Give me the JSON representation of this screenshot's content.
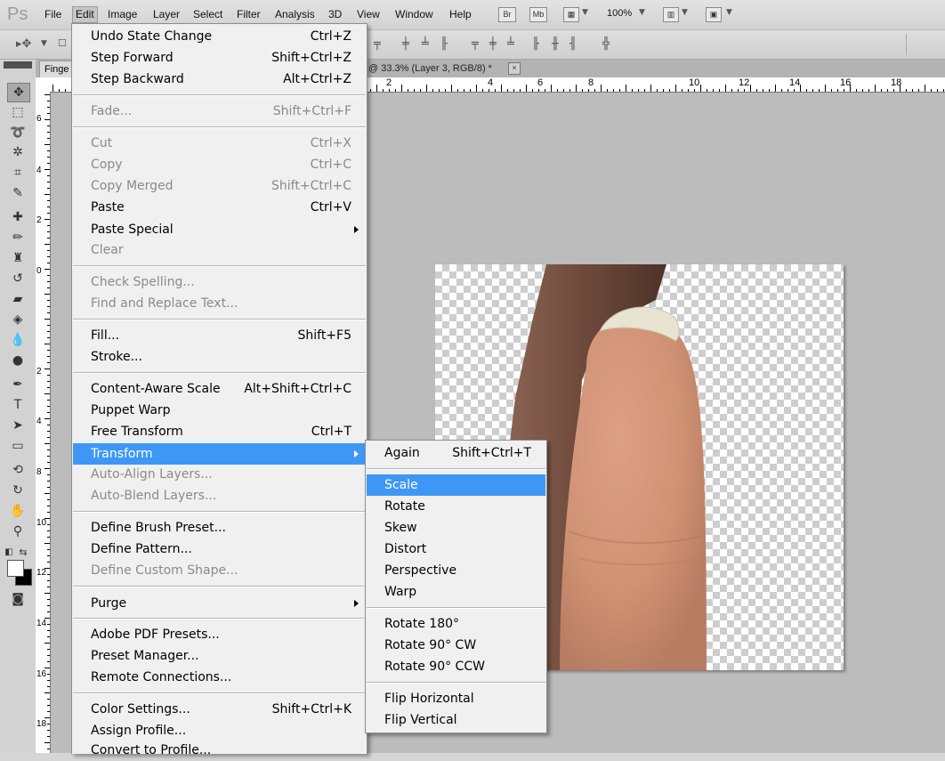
{
  "app": {
    "logo": "Ps"
  },
  "menubar": {
    "items": [
      "File",
      "Edit",
      "Image",
      "Layer",
      "Select",
      "Filter",
      "Analysis",
      "3D",
      "View",
      "Window",
      "Help"
    ],
    "active": "Edit",
    "bridge_label": "Br",
    "minibridge_label": "Mb",
    "zoom": "100%"
  },
  "document": {
    "tab_left": "Finge",
    "tab_right": "@ 33.3% (Layer 3, RGB/8) *",
    "close_glyph": "×"
  },
  "rulers": {
    "top_labels": [
      "2",
      "4",
      "6",
      "8",
      "10",
      "12",
      "14",
      "16",
      "18"
    ],
    "left_labels": [
      "6",
      "4",
      "2",
      "0",
      "2",
      "4",
      "6",
      "8",
      "10",
      "12",
      "14",
      "16",
      "18"
    ]
  },
  "edit_menu": {
    "items": [
      {
        "label": "Undo State Change",
        "shortcut": "Ctrl+Z",
        "disabled": false
      },
      {
        "label": "Step Forward",
        "shortcut": "Shift+Ctrl+Z",
        "disabled": false
      },
      {
        "label": "Step Backward",
        "shortcut": "Alt+Ctrl+Z",
        "disabled": false
      },
      {
        "label": "Fade...",
        "shortcut": "Shift+Ctrl+F",
        "disabled": true
      },
      {
        "label": "Cut",
        "shortcut": "Ctrl+X",
        "disabled": true
      },
      {
        "label": "Copy",
        "shortcut": "Ctrl+C",
        "disabled": true
      },
      {
        "label": "Copy Merged",
        "shortcut": "Shift+Ctrl+C",
        "disabled": true
      },
      {
        "label": "Paste",
        "shortcut": "Ctrl+V",
        "disabled": false
      },
      {
        "label": "Paste Special",
        "shortcut": "",
        "disabled": false,
        "submenu": true
      },
      {
        "label": "Clear",
        "shortcut": "",
        "disabled": true
      },
      {
        "label": "Check Spelling...",
        "shortcut": "",
        "disabled": true
      },
      {
        "label": "Find and Replace Text...",
        "shortcut": "",
        "disabled": true
      },
      {
        "label": "Fill...",
        "shortcut": "Shift+F5",
        "disabled": false
      },
      {
        "label": "Stroke...",
        "shortcut": "",
        "disabled": false
      },
      {
        "label": "Content-Aware Scale",
        "shortcut": "Alt+Shift+Ctrl+C",
        "disabled": false
      },
      {
        "label": "Puppet Warp",
        "shortcut": "",
        "disabled": false
      },
      {
        "label": "Free Transform",
        "shortcut": "Ctrl+T",
        "disabled": false
      },
      {
        "label": "Transform",
        "shortcut": "",
        "disabled": false,
        "submenu": true,
        "highlighted": true
      },
      {
        "label": "Auto-Align Layers...",
        "shortcut": "",
        "disabled": true
      },
      {
        "label": "Auto-Blend Layers...",
        "shortcut": "",
        "disabled": true
      },
      {
        "label": "Define Brush Preset...",
        "shortcut": "",
        "disabled": false
      },
      {
        "label": "Define Pattern...",
        "shortcut": "",
        "disabled": false
      },
      {
        "label": "Define Custom Shape...",
        "shortcut": "",
        "disabled": true
      },
      {
        "label": "Purge",
        "shortcut": "",
        "disabled": false,
        "submenu": true
      },
      {
        "label": "Adobe PDF Presets...",
        "shortcut": "",
        "disabled": false
      },
      {
        "label": "Preset Manager...",
        "shortcut": "",
        "disabled": false
      },
      {
        "label": "Remote Connections...",
        "shortcut": "",
        "disabled": false
      },
      {
        "label": "Color Settings...",
        "shortcut": "Shift+Ctrl+K",
        "disabled": false
      },
      {
        "label": "Assign Profile...",
        "shortcut": "",
        "disabled": false
      },
      {
        "label": "Convert to Profile...",
        "shortcut": "",
        "disabled": false
      }
    ]
  },
  "transform_menu": {
    "items": [
      {
        "label": "Again",
        "shortcut": "Shift+Ctrl+T"
      },
      {
        "label": "Scale",
        "shortcut": "",
        "highlighted": true
      },
      {
        "label": "Rotate",
        "shortcut": ""
      },
      {
        "label": "Skew",
        "shortcut": ""
      },
      {
        "label": "Distort",
        "shortcut": ""
      },
      {
        "label": "Perspective",
        "shortcut": ""
      },
      {
        "label": "Warp",
        "shortcut": ""
      },
      {
        "label": "Rotate 180°",
        "shortcut": ""
      },
      {
        "label": "Rotate 90° CW",
        "shortcut": ""
      },
      {
        "label": "Rotate 90° CCW",
        "shortcut": ""
      },
      {
        "label": "Flip Horizontal",
        "shortcut": ""
      },
      {
        "label": "Flip Vertical",
        "shortcut": ""
      }
    ]
  },
  "colors": {
    "highlight": "#3f97f5",
    "menu_bg": "#f0f0f0",
    "workspace": "#bcbcbc"
  }
}
